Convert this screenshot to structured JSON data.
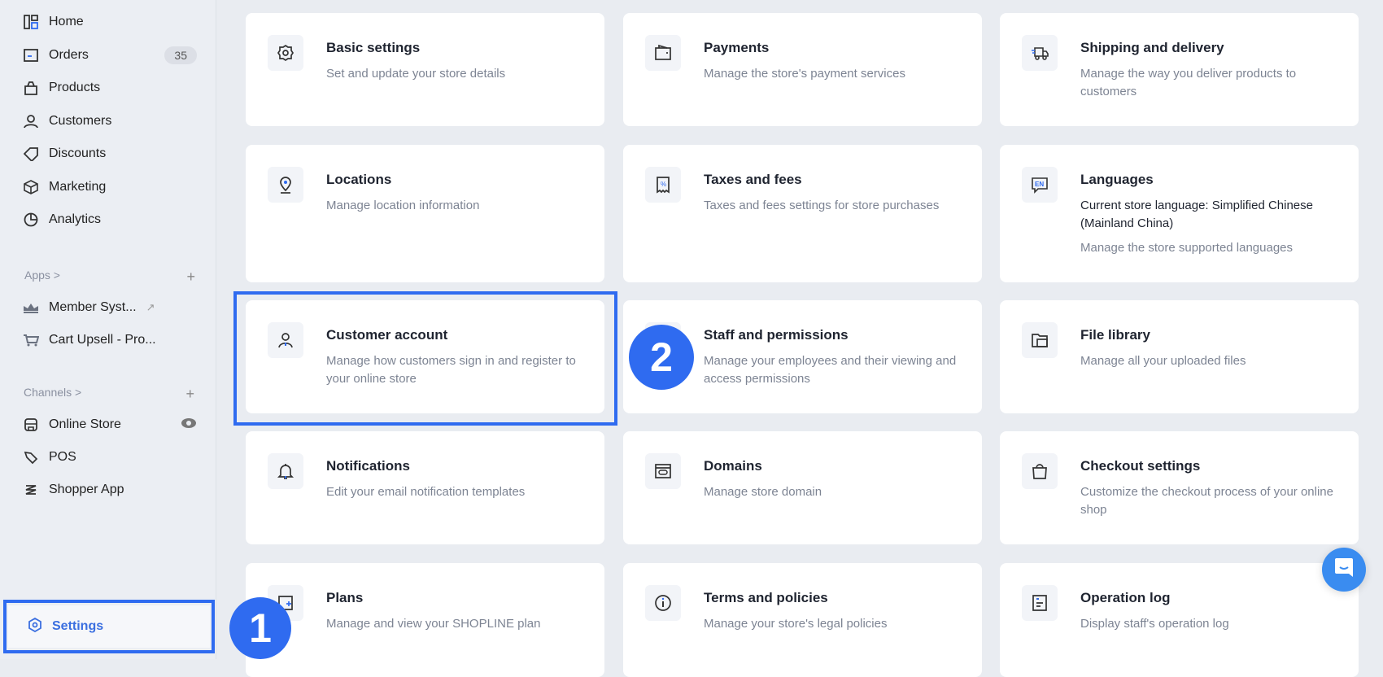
{
  "sidebar": {
    "items": [
      {
        "label": "Home",
        "icon": "dashboard-icon"
      },
      {
        "label": "Orders",
        "icon": "orders-icon",
        "badge": "35"
      },
      {
        "label": "Products",
        "icon": "bag-icon"
      },
      {
        "label": "Customers",
        "icon": "person-icon"
      },
      {
        "label": "Discounts",
        "icon": "tag-icon"
      },
      {
        "label": "Marketing",
        "icon": "cube-icon"
      },
      {
        "label": "Analytics",
        "icon": "pie-chart-icon"
      }
    ],
    "apps_label": "Apps >",
    "apps": [
      {
        "label": "Member Syst...",
        "icon": "crown-icon"
      },
      {
        "label": "Cart Upsell - Pro...",
        "icon": "cart-icon"
      }
    ],
    "channels_label": "Channels >",
    "channels": [
      {
        "label": "Online Store",
        "icon": "store-icon"
      },
      {
        "label": "POS",
        "icon": "pos-icon"
      },
      {
        "label": "Shopper App",
        "icon": "layers-icon"
      }
    ],
    "settings_label": "Settings"
  },
  "cards": [
    {
      "title": "Basic settings",
      "desc": "Set and update your store details",
      "icon": "gear-icon"
    },
    {
      "title": "Payments",
      "desc": "Manage the store's payment services",
      "icon": "wallet-icon"
    },
    {
      "title": "Shipping and delivery",
      "desc": "Manage the way you deliver products to customers",
      "icon": "truck-icon"
    },
    {
      "title": "Locations",
      "desc": "Manage location information",
      "icon": "location-pin-icon"
    },
    {
      "title": "Taxes and fees",
      "desc": "Taxes and fees settings for store purchases",
      "icon": "receipt-icon"
    },
    {
      "title": "Languages",
      "extra": "Current store language: Simplified Chinese (Mainland China)",
      "desc": "Manage the store supported languages",
      "icon": "language-icon"
    },
    {
      "title": "Customer account",
      "desc": "Manage how customers sign in and register to your online store",
      "icon": "user-icon"
    },
    {
      "title": "Staff and permissions",
      "desc": "Manage your employees and their viewing and access permissions",
      "icon": "staff-icon"
    },
    {
      "title": "File library",
      "desc": "Manage all your uploaded files",
      "icon": "folder-icon"
    },
    {
      "title": "Notifications",
      "desc": "Edit your email notification templates",
      "icon": "bell-icon"
    },
    {
      "title": "Domains",
      "desc": "Manage store domain",
      "icon": "domain-icon"
    },
    {
      "title": "Checkout settings",
      "desc": "Customize the checkout process of your online shop",
      "icon": "shopping-bag-icon"
    },
    {
      "title": "Plans",
      "desc": "Manage and view your SHOPLINE plan",
      "icon": "plans-icon"
    },
    {
      "title": "Terms and policies",
      "desc": "Manage your store's legal policies",
      "icon": "info-icon"
    },
    {
      "title": "Operation log",
      "desc": "Display staff's operation log",
      "icon": "log-icon"
    }
  ],
  "steps": [
    "1",
    "2"
  ],
  "language_badge": "EN"
}
